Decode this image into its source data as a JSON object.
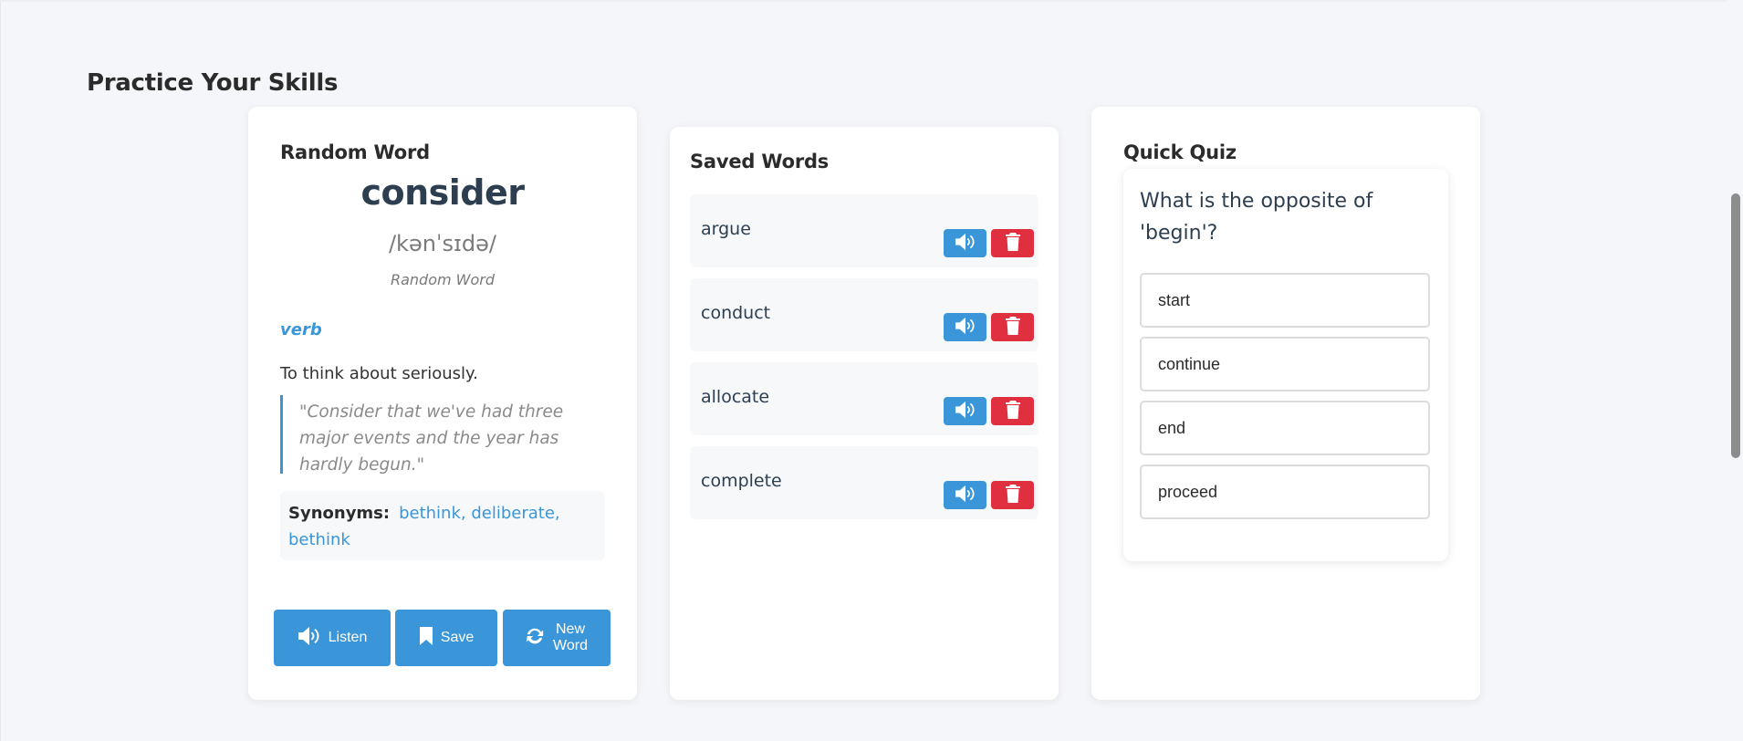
{
  "section": {
    "title": "Practice Your Skills"
  },
  "random_word": {
    "heading": "Random Word",
    "word": "consider",
    "phonetic": "/kənˈsɪdə/",
    "tag": "Random Word",
    "part_of_speech": "verb",
    "definition": "To think about seriously.",
    "example": "\"Consider that we've had three major events and the year has hardly begun.\"",
    "synonyms_label": "Synonyms:",
    "synonyms": "bethink, deliberate, bethink",
    "buttons": {
      "listen": "Listen",
      "save": "Save",
      "new_word": "New Word"
    }
  },
  "saved_words": {
    "heading": "Saved Words",
    "items": [
      {
        "word": "argue"
      },
      {
        "word": "conduct"
      },
      {
        "word": "allocate"
      },
      {
        "word": "complete"
      }
    ]
  },
  "quiz": {
    "heading": "Quick Quiz",
    "question": "What is the opposite of 'begin'?",
    "options": [
      "start",
      "continue",
      "end",
      "proceed"
    ]
  },
  "colors": {
    "accent": "#3a96d8",
    "danger": "#e0303f",
    "background": "#f5f6f9"
  },
  "icons": {
    "speaker": "volume-icon",
    "trash": "trash-icon",
    "bookmark": "bookmark-icon",
    "refresh": "refresh-icon"
  }
}
